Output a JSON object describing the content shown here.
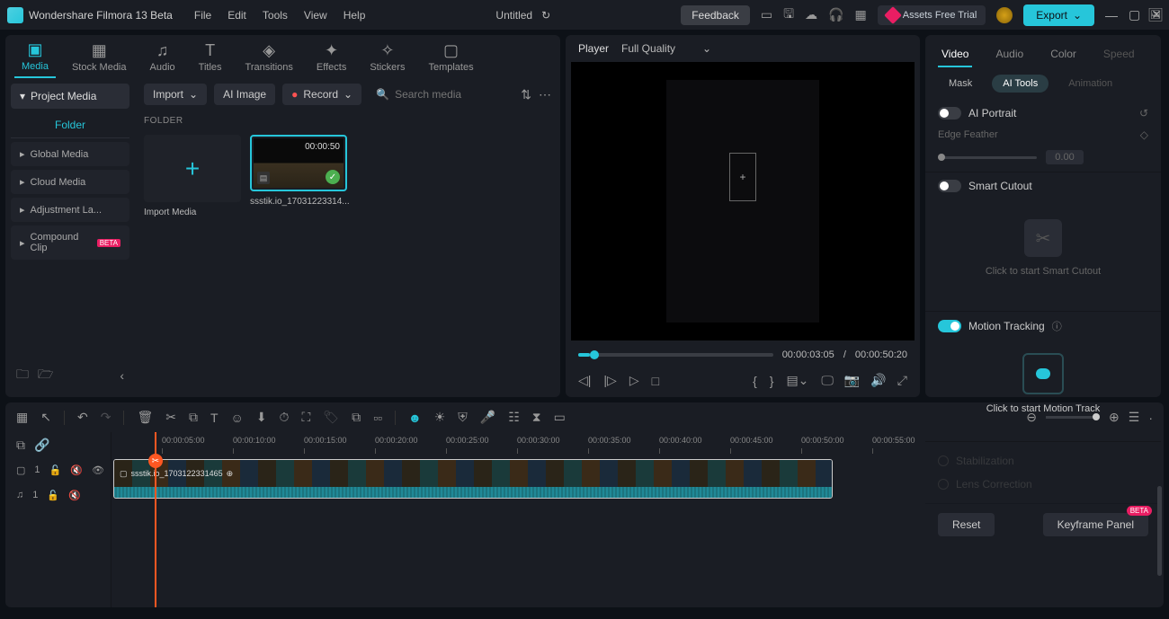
{
  "app": {
    "name": "Wondershare Filmora 13 Beta",
    "title": "Untitled"
  },
  "menus": [
    "File",
    "Edit",
    "Tools",
    "View",
    "Help"
  ],
  "titlebar": {
    "feedback": "Feedback",
    "assets": "Assets Free Trial",
    "export": "Export"
  },
  "mediaTabs": [
    {
      "label": "Media",
      "icon": "▣"
    },
    {
      "label": "Stock Media",
      "icon": "▦"
    },
    {
      "label": "Audio",
      "icon": "♫"
    },
    {
      "label": "Titles",
      "icon": "T"
    },
    {
      "label": "Transitions",
      "icon": "◈"
    },
    {
      "label": "Effects",
      "icon": "✦"
    },
    {
      "label": "Stickers",
      "icon": "✧"
    },
    {
      "label": "Templates",
      "icon": "▢"
    }
  ],
  "sidebar": {
    "head": "Project Media",
    "folder": "Folder",
    "items": [
      "Global Media",
      "Cloud Media",
      "Adjustment La...",
      "Compound Clip"
    ]
  },
  "contentBar": {
    "import": "Import",
    "aiImage": "AI Image",
    "record": "Record",
    "searchPlaceholder": "Search media"
  },
  "folderLabel": "FOLDER",
  "mediaGrid": {
    "importLabel": "Import Media",
    "clip": {
      "duration": "00:00:50",
      "name": "ssstik.io_17031223314..."
    },
    "clipTimeline": "ssstik.io_1703122331465"
  },
  "player": {
    "title": "Player",
    "quality": "Full Quality",
    "current": "00:00:03:05",
    "sep": "/",
    "total": "00:00:50:20"
  },
  "props": {
    "tabs": [
      "Video",
      "Audio",
      "Color",
      "Speed"
    ],
    "subTabs": [
      "Mask",
      "AI Tools",
      "Animation"
    ],
    "aiPortrait": "AI Portrait",
    "edgeFeather": "Edge Feather",
    "edgeVal": "0.00",
    "smartCutout": "Smart Cutout",
    "cutoutText": "Click to start Smart Cutout",
    "motionTracking": "Motion Tracking",
    "motionText": "Click to start Motion Track",
    "stabilization": "Stabilization",
    "lensCorrection": "Lens Correction",
    "reset": "Reset",
    "keyframe": "Keyframe Panel",
    "beta": "BETA"
  },
  "timeline": {
    "ticks": [
      "00:00:05:00",
      "00:00:10:00",
      "00:00:15:00",
      "00:00:20:00",
      "00:00:25:00",
      "00:00:30:00",
      "00:00:35:00",
      "00:00:40:00",
      "00:00:45:00",
      "00:00:50:00",
      "00:00:55:00"
    ],
    "track1": "1",
    "track2": "1"
  }
}
